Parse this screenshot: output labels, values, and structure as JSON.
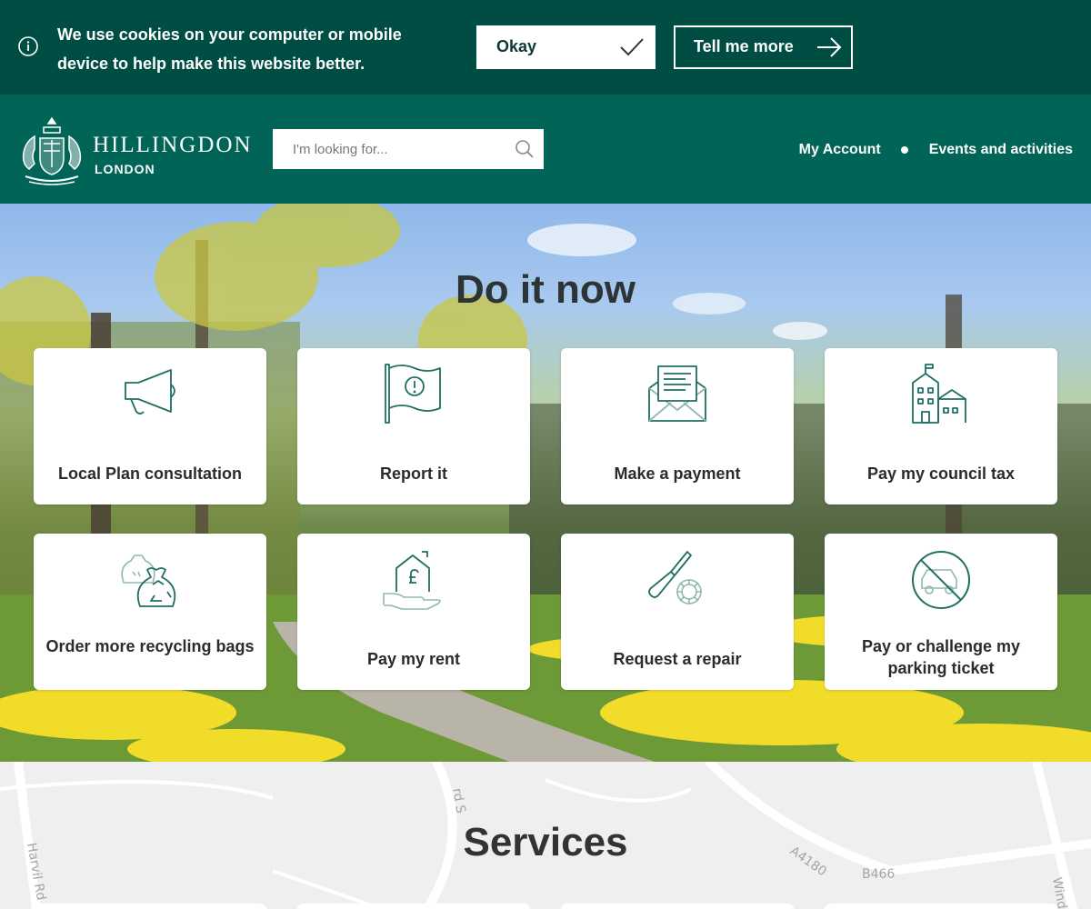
{
  "cookie": {
    "text": "We use cookies on your computer or mobile device to help make this website better.",
    "okay_label": "Okay",
    "more_label": "Tell me more"
  },
  "header": {
    "logo_name": "HILLINGDON",
    "logo_sub": "LONDON",
    "search_placeholder": "I'm looking for...",
    "nav": [
      "My Account",
      "Events and activities"
    ]
  },
  "hero": {
    "title": "Do it now",
    "cards": [
      {
        "label": "Local Plan consultation",
        "icon": "megaphone-icon"
      },
      {
        "label": "Report it",
        "icon": "flag-alert-icon"
      },
      {
        "label": "Make a payment",
        "icon": "envelope-letter-icon"
      },
      {
        "label": "Pay my council tax",
        "icon": "town-hall-icon"
      },
      {
        "label": "Order more recycling bags",
        "icon": "recycling-bags-icon"
      },
      {
        "label": "Pay my rent",
        "icon": "house-hand-icon"
      },
      {
        "label": "Request a repair",
        "icon": "tools-icon"
      },
      {
        "label": "Pay or challenge my parking ticket",
        "icon": "no-parking-car-icon"
      }
    ]
  },
  "services": {
    "title": "Services",
    "map_labels": [
      "Harvil Rd",
      "A4180",
      "B466",
      "Wind",
      "rd S"
    ]
  },
  "colors": {
    "banner": "#004d44",
    "header": "#006557",
    "icon": "#1f6f63"
  }
}
